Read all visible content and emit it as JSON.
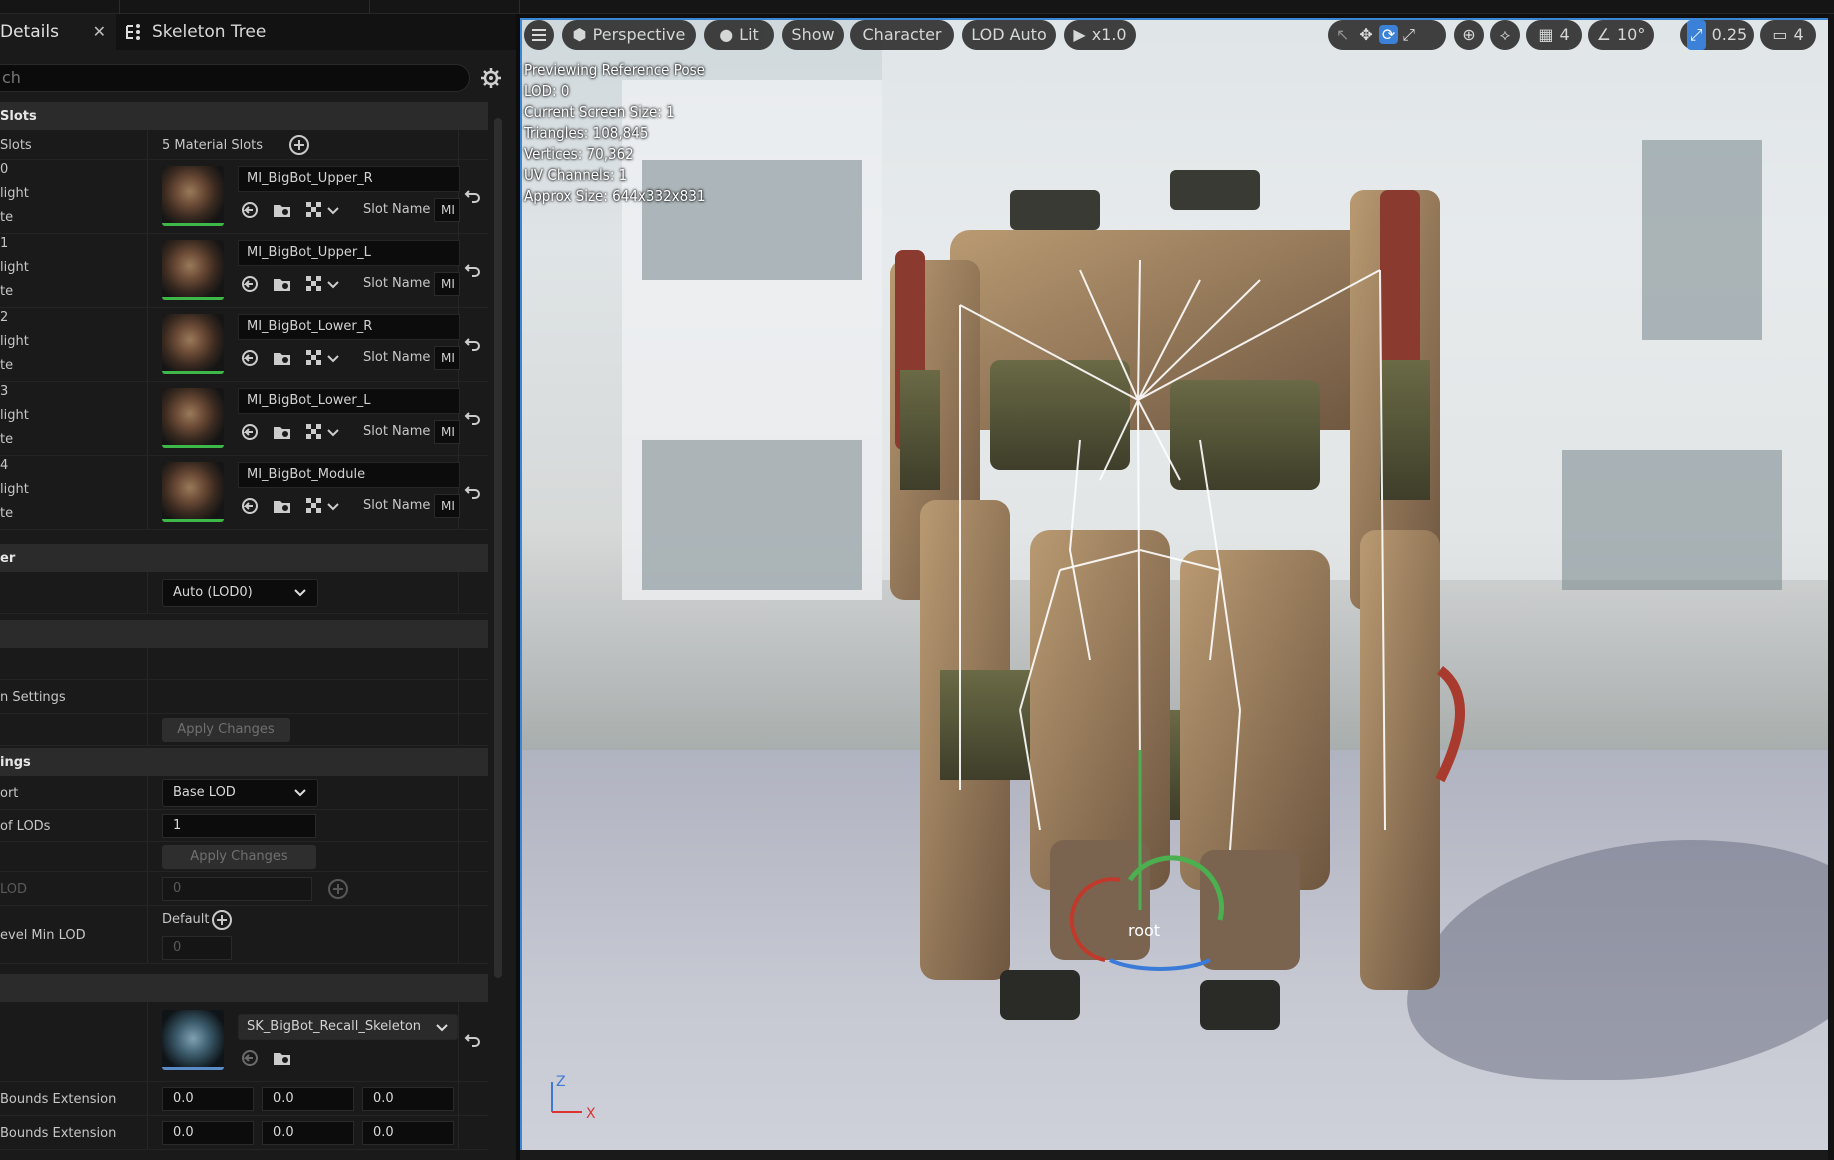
{
  "tabs": {
    "details": "Details",
    "skeleton_tree": "Skeleton Tree"
  },
  "search": {
    "value": "ch"
  },
  "material_slots": {
    "category": "Slots",
    "row_label": "Slots",
    "count_label": "5 Material Slots",
    "slot_name_label": "Slot Name",
    "slot_value": "MI",
    "items": [
      {
        "index": "0",
        "highlight": "light",
        "isolate": "te",
        "name": "MI_BigBot_Upper_R"
      },
      {
        "index": "1",
        "highlight": "light",
        "isolate": "te",
        "name": "MI_BigBot_Upper_L"
      },
      {
        "index": "2",
        "highlight": "light",
        "isolate": "te",
        "name": "MI_BigBot_Lower_R"
      },
      {
        "index": "3",
        "highlight": "light",
        "isolate": "te",
        "name": "MI_BigBot_Lower_L"
      },
      {
        "index": "4",
        "highlight": "light",
        "isolate": "te",
        "name": "MI_BigBot_Module"
      }
    ]
  },
  "lod_picker": {
    "category": "er",
    "value": "Auto (LOD0)"
  },
  "build": {
    "settings_label": "n Settings",
    "apply": "Apply Changes"
  },
  "lod_settings": {
    "category": "ings",
    "import_label": "ort",
    "import_value": "Base LOD",
    "num_lods_label": "of LODs",
    "num_lods_value": "1",
    "apply": "Apply Changes",
    "min_lod_label": "LOD",
    "min_lod_value": "0",
    "quality_label": "evel Min LOD",
    "default_label": "Default",
    "default_value": "0"
  },
  "skeleton": {
    "asset": "SK_BigBot_Recall_Skeleton",
    "pos_bounds_label": "Bounds Extension",
    "neg_bounds_label": " Bounds Extension",
    "pos_values": [
      "0.0",
      "0.0",
      "0.0"
    ],
    "neg_values": [
      "0.0",
      "0.0",
      "0.0"
    ]
  },
  "viewport": {
    "menu_icon": "hamburger-icon",
    "perspective": "Perspective",
    "lit": "Lit",
    "show": "Show",
    "character": "Character",
    "lod": "LOD Auto",
    "speed": "x1.0",
    "grid_snap": "4",
    "rot_snap": "10°",
    "scale_snap": "0.25",
    "cam_speed": "4",
    "root_label": "root",
    "axis_z": "Z",
    "axis_x": "X"
  },
  "stats": [
    "Previewing Reference Pose",
    "LOD: 0",
    "Current Screen Size: 1",
    "Triangles: 108,845",
    "Vertices: 70,362",
    "UV Channels: 1",
    "Approx Size: 644x332x831"
  ],
  "colors": {
    "accent": "#2f7ad6",
    "thumb_bar": "#3fb84a"
  }
}
